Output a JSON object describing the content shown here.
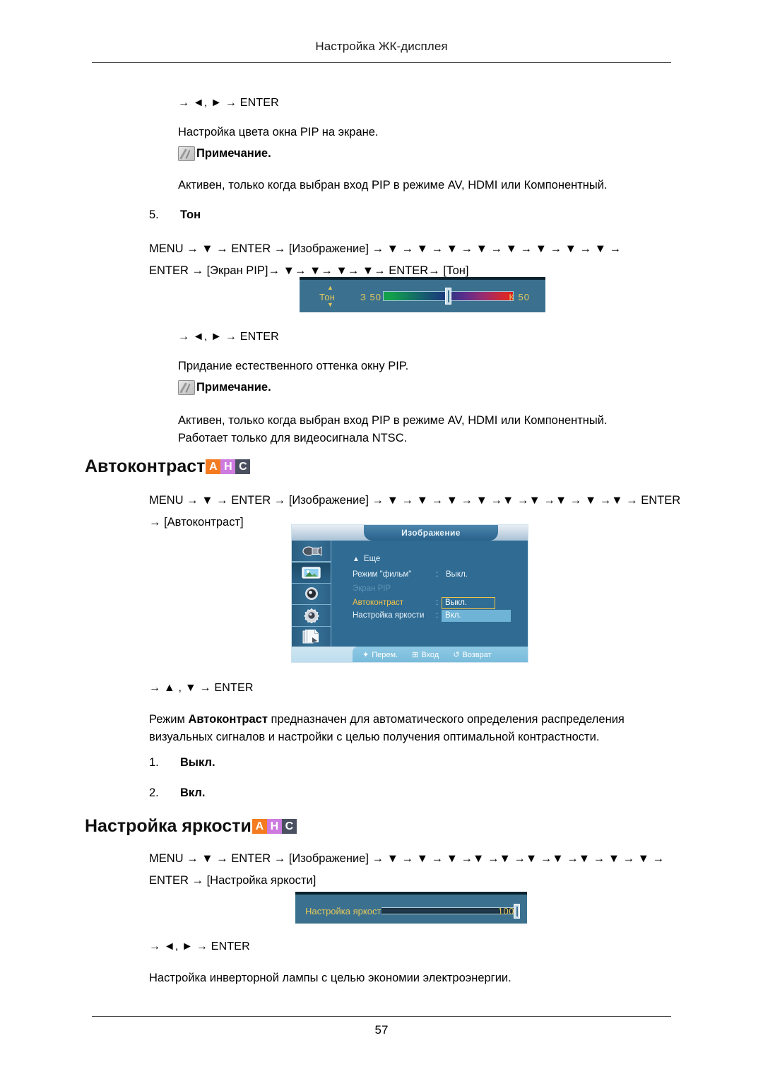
{
  "header": {
    "title": "Настройка ЖК-дисплея"
  },
  "footer": {
    "page_number": "57"
  },
  "sections": {
    "pip_color": {
      "key_line": "→ ◄, ► → ENTER",
      "description": "Настройка цвета окна PIP на экране.",
      "note_label": "Примечание.",
      "note_text": "Активен, только когда выбран вход PIP в режиме AV, HDMI или Компонентный."
    },
    "tone": {
      "item_number": "5.",
      "item_title": "Тон",
      "path_line1": "MENU → ▼ → ENTER → [Изображение] → ▼ → ▼ → ▼ → ▼ → ▼ → ▼ → ▼ → ▼ →",
      "path_line2": "ENTER → [Экран PIP]→ ▼→ ▼→ ▼→ ▼→ ENTER→ [Тон]",
      "osd": {
        "label": "Тон",
        "green_key": "З",
        "green_value": "50",
        "red_key": "К",
        "red_value": "50",
        "up_arrow": "▲",
        "down_arrow": "▼"
      },
      "key_line": "→ ◄, ► → ENTER",
      "description": "Придание естественного оттенка окну PIP.",
      "note_label": "Примечание.",
      "note_text_line1": "Активен, только когда выбран вход PIP в режиме AV, HDMI или Компонентный.",
      "note_text_line2": "Работает только для видеосигнала NTSC."
    },
    "auto_contrast": {
      "heading": "Автоконтраст",
      "badges": [
        "A",
        "H",
        "C"
      ],
      "badge_colors": [
        "#F47B20",
        "#CE7BE0",
        "#4A5060"
      ],
      "path_line1": "MENU → ▼ → ENTER → [Изображение] → ▼ → ▼ → ▼ → ▼ →▼ →▼ →▼ → ▼ →▼ → ENTER",
      "path_line2": "→ [Автоконтраст]",
      "osd": {
        "title": "Изображение",
        "more_label": "Еще",
        "rows": [
          {
            "label": "Режим \"фильм\"",
            "value": "Выкл."
          },
          {
            "label": "Экран PIP",
            "value": ""
          },
          {
            "label": "Автоконтраст",
            "value": "Выкл."
          },
          {
            "label": "Настройка яркости",
            "value": "Вкл."
          }
        ],
        "footer": [
          {
            "icon": "move-icon",
            "label": "Перем."
          },
          {
            "icon": "enter-icon",
            "label": "Вход"
          },
          {
            "icon": "return-icon",
            "label": "Возврат"
          }
        ],
        "side_icons": [
          "projector-icon",
          "picture-icon",
          "speaker-icon",
          "gear-icon",
          "pages-icon"
        ]
      },
      "key_line": "→ ▲ , ▼ → ENTER",
      "description_line1": "Режим Автоконтраст предназначен для автоматического определения распределения",
      "description_bold": "Автоконтраст",
      "description_line2": "визуальных сигналов и настройки с целью получения оптимальной контрастности.",
      "options": [
        {
          "number": "1.",
          "label": "Выкл."
        },
        {
          "number": "2.",
          "label": "Вкл."
        }
      ]
    },
    "brightness": {
      "heading": "Настройка яркости",
      "badges": [
        "A",
        "H",
        "C"
      ],
      "path_line1": "MENU → ▼ → ENTER → [Изображение] → ▼ → ▼ → ▼ →▼ →▼ →▼ →▼ →▼ → ▼ → ▼ →",
      "path_line2": "ENTER → [Настройка яркости]",
      "osd": {
        "label": "Настройка яркости",
        "value": "100"
      },
      "key_line": "→ ◄, ► → ENTER",
      "description": "Настройка инверторной лампы с целью экономии электроэнергии."
    }
  }
}
